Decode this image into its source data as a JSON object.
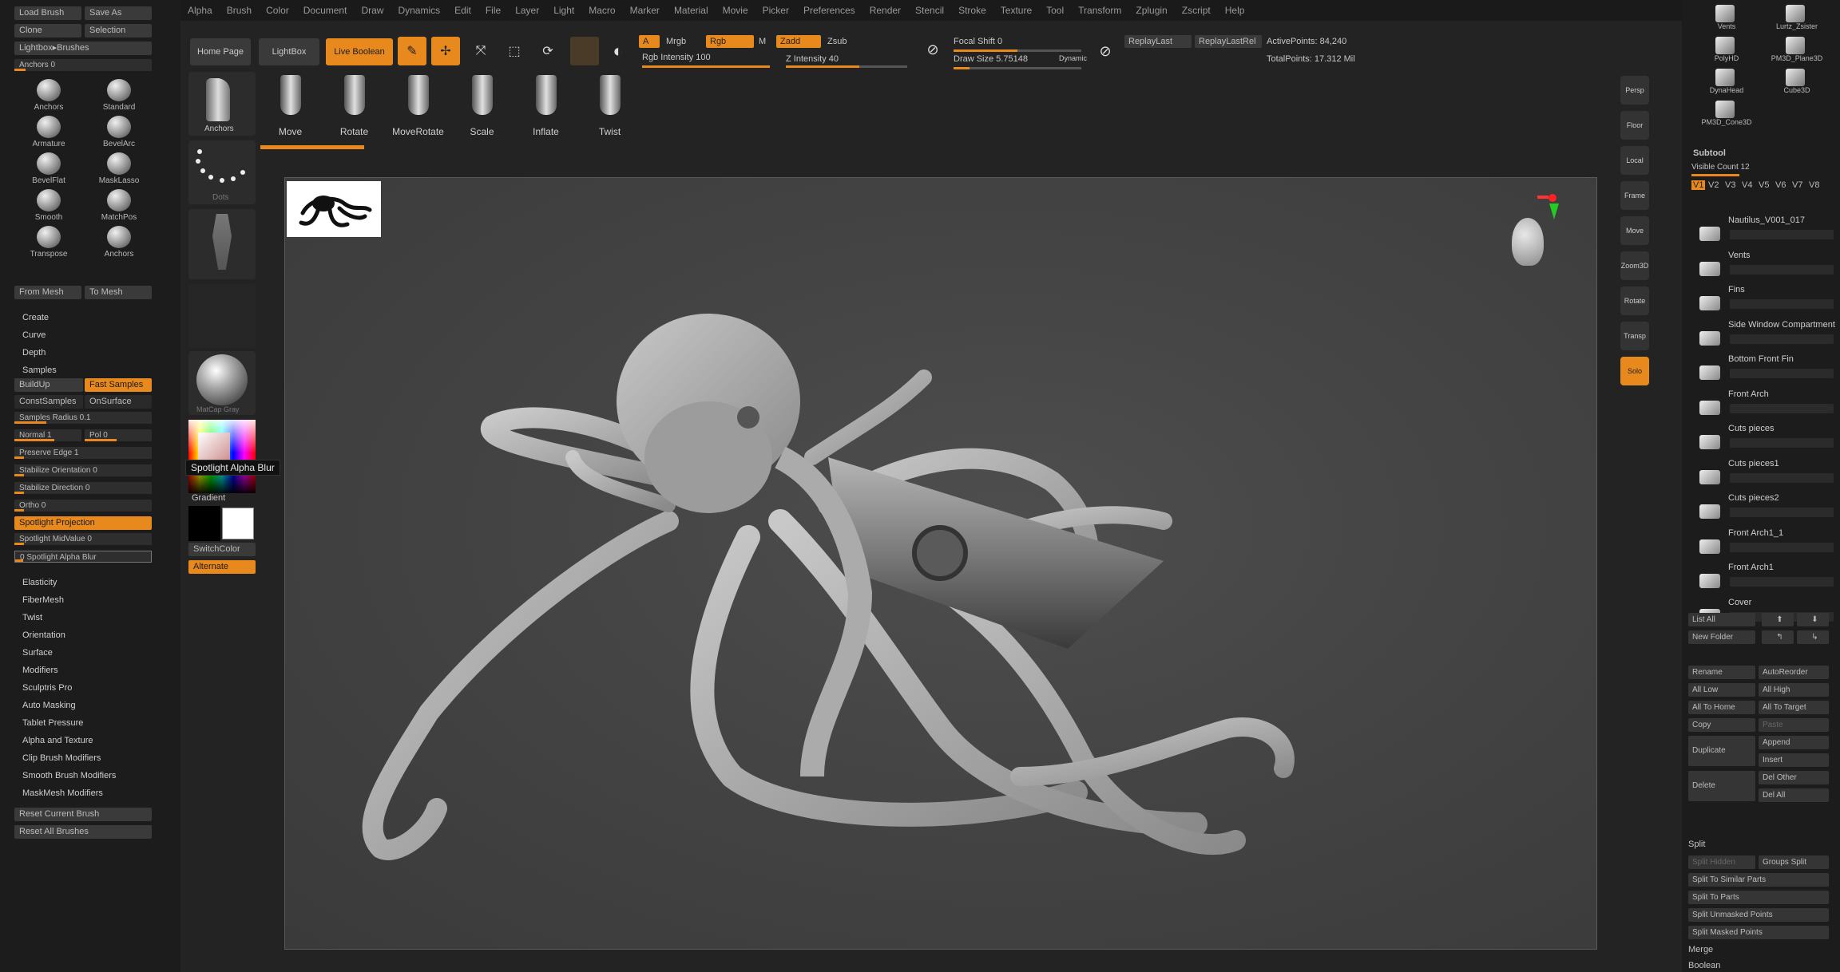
{
  "menu": [
    "Alpha",
    "Brush",
    "Color",
    "Document",
    "Draw",
    "Dynamics",
    "Edit",
    "File",
    "Layer",
    "Light",
    "Macro",
    "Marker",
    "Material",
    "Movie",
    "Picker",
    "Preferences",
    "Render",
    "Stencil",
    "Stroke",
    "Texture",
    "Tool",
    "Transform",
    "Zplugin",
    "Zscript",
    "Help"
  ],
  "left": {
    "load_brush": "Load Brush",
    "save_as": "Save As",
    "clone": "Clone",
    "selection": "Selection",
    "lightbox_brushes": "Lightbox▸Brushes",
    "anchors_slider": "Anchors 0",
    "brushes": [
      "Anchors",
      "Standard",
      "Armature",
      "BevelArc",
      "BevelFlat",
      "MaskLasso",
      "Smooth",
      "MatchPos",
      "Transpose",
      "Anchors"
    ],
    "from_mesh": "From Mesh",
    "to_mesh": "To Mesh",
    "create": "Create",
    "curve": "Curve",
    "depth": "Depth",
    "samples": "Samples",
    "buildup": "BuildUp",
    "fast_samples": "Fast Samples",
    "constsamples": "ConstSamples",
    "onsurface": "OnSurface",
    "sliders": [
      "Samples Radius 0.1",
      "Normal 1",
      "Pol 0",
      "Preserve Edge 1",
      "Stabilize Orientation 0",
      "Stabilize Direction 0",
      "Ortho 0"
    ],
    "spotlight_projection": "Spotlight Projection",
    "spotlight_midvalue": "Spotlight MidValue 0",
    "spotlight_alpha_blur": "0 Spotlight Alpha Blur",
    "sections": [
      "Elasticity",
      "FiberMesh",
      "Twist",
      "Orientation",
      "Surface",
      "Modifiers",
      "Sculptris Pro",
      "Auto Masking",
      "Tablet Pressure",
      "Alpha and Texture",
      "Clip Brush Modifiers",
      "Smooth Brush Modifiers",
      "MaskMesh Modifiers"
    ],
    "reset_current": "Reset Current Brush",
    "reset_all": "Reset All Brushes"
  },
  "col2": {
    "anchors": "Anchors",
    "dots": "Dots",
    "matcap_gray": "MatCap Gray",
    "gradient": "Gradient",
    "switchcolor": "SwitchColor",
    "alternate": "Alternate",
    "tooltip": "Spotlight Alpha Blur"
  },
  "shelf": {
    "home_page": "Home Page",
    "lightbox": "LightBox",
    "live_boolean": "Live Boolean",
    "edit": "Edit",
    "draw": "Draw",
    "move": "Move",
    "scale": "Scale",
    "rotate": "Rotate",
    "a": "A",
    "mrgb": "Mrgb",
    "rgb": "Rgb",
    "m": "M",
    "zadd": "Zadd",
    "zsub": "Zsub",
    "rgb_intensity": "Rgb Intensity 100",
    "z_intensity": "Z Intensity 40",
    "focal_shift": "Focal Shift 0",
    "draw_size": "Draw Size 5.75148",
    "dynamic": "Dynamic",
    "replay_last": "ReplayLast",
    "replay_last_rel": "ReplayLastRel",
    "active_points": "ActivePoints: 84,240",
    "total_points": "TotalPoints: 17.312 Mil",
    "quick_brushes": [
      "Move",
      "Rotate",
      "MoveRotate",
      "Scale",
      "Inflate",
      "Twist"
    ]
  },
  "righticons": [
    "Persp",
    "Floor",
    "Local",
    "Frame",
    "Move",
    "Zoom3D",
    "Rotate",
    "Transp",
    "Solo"
  ],
  "right": {
    "top_tools": [
      "Vents",
      "Lurtz_Zsister",
      "PolyHD",
      "PM3D_Plane3D",
      "DynaHead",
      "Cube3D",
      "PM3D_Cone3D"
    ],
    "subtool": "Subtool",
    "visible_count": "Visible Count 12",
    "v_buttons": [
      "V1",
      "V2",
      "V3",
      "V4",
      "V5",
      "V6",
      "V7",
      "V8"
    ],
    "subtools": [
      "Nautilus_V001_017",
      "Vents",
      "Fins",
      "Side Window Compartment",
      "Bottom Front Fin",
      "Front Arch",
      "Cuts pieces",
      "Cuts pieces1",
      "Cuts pieces2",
      "Front Arch1_1",
      "Front Arch1",
      "Cover"
    ],
    "list_all": "List All",
    "new_folder": "New Folder",
    "rename": "Rename",
    "autoreorder": "AutoReorder",
    "all_low": "All Low",
    "all_high": "All High",
    "all_to_home": "All To Home",
    "all_to_target": "All To Target",
    "copy": "Copy",
    "paste": "Paste",
    "duplicate": "Duplicate",
    "append": "Append",
    "insert": "Insert",
    "delete": "Delete",
    "del_other": "Del Other",
    "del_all": "Del All",
    "split": "Split",
    "split_hidden": "Split Hidden",
    "groups_split": "Groups Split",
    "split_similar": "Split To Similar Parts",
    "split_parts": "Split To Parts",
    "split_unmasked": "Split Unmasked Points",
    "split_masked": "Split Masked Points",
    "merge": "Merge",
    "boolean": "Boolean"
  },
  "colors": {
    "accent": "#e8891e",
    "panel": "#1c1c1c",
    "viewport": "#444444"
  }
}
